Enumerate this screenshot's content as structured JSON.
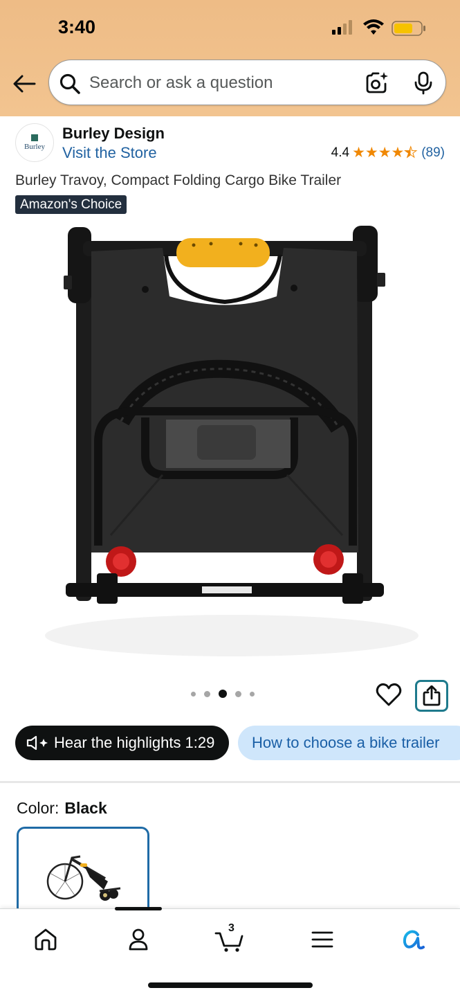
{
  "status_bar": {
    "time": "3:40"
  },
  "search": {
    "placeholder": "Search or ask a question"
  },
  "brand": {
    "logo_text": "Burley",
    "name": "Burley Design",
    "store_link": "Visit the Store"
  },
  "rating": {
    "value": "4.4",
    "stars": 4.5,
    "count": "(89)"
  },
  "product": {
    "title": "Burley Travoy, Compact Folding Cargo Bike Trailer",
    "badge": "Amazon's Choice",
    "image_count": 5,
    "active_image_index": 2
  },
  "pills": {
    "hear_highlights": "Hear the highlights 1:29",
    "how_to_choose": "How to choose a bike trailer"
  },
  "color": {
    "label": "Color:",
    "value": "Black"
  },
  "bottom_nav": {
    "items": [
      "home-icon",
      "account-icon",
      "cart-icon",
      "menu-icon",
      "rufus-icon"
    ],
    "cart_count": "3"
  },
  "colors": {
    "header_bg": "#f2c490",
    "link": "#2162a1",
    "star": "#f08804",
    "badge_bg": "#232f3e",
    "pill_dark": "#0f1111",
    "pill_light": "#cfe6fb",
    "share_border": "#1e7a8c",
    "swatch_border": "#1f6ba6"
  }
}
